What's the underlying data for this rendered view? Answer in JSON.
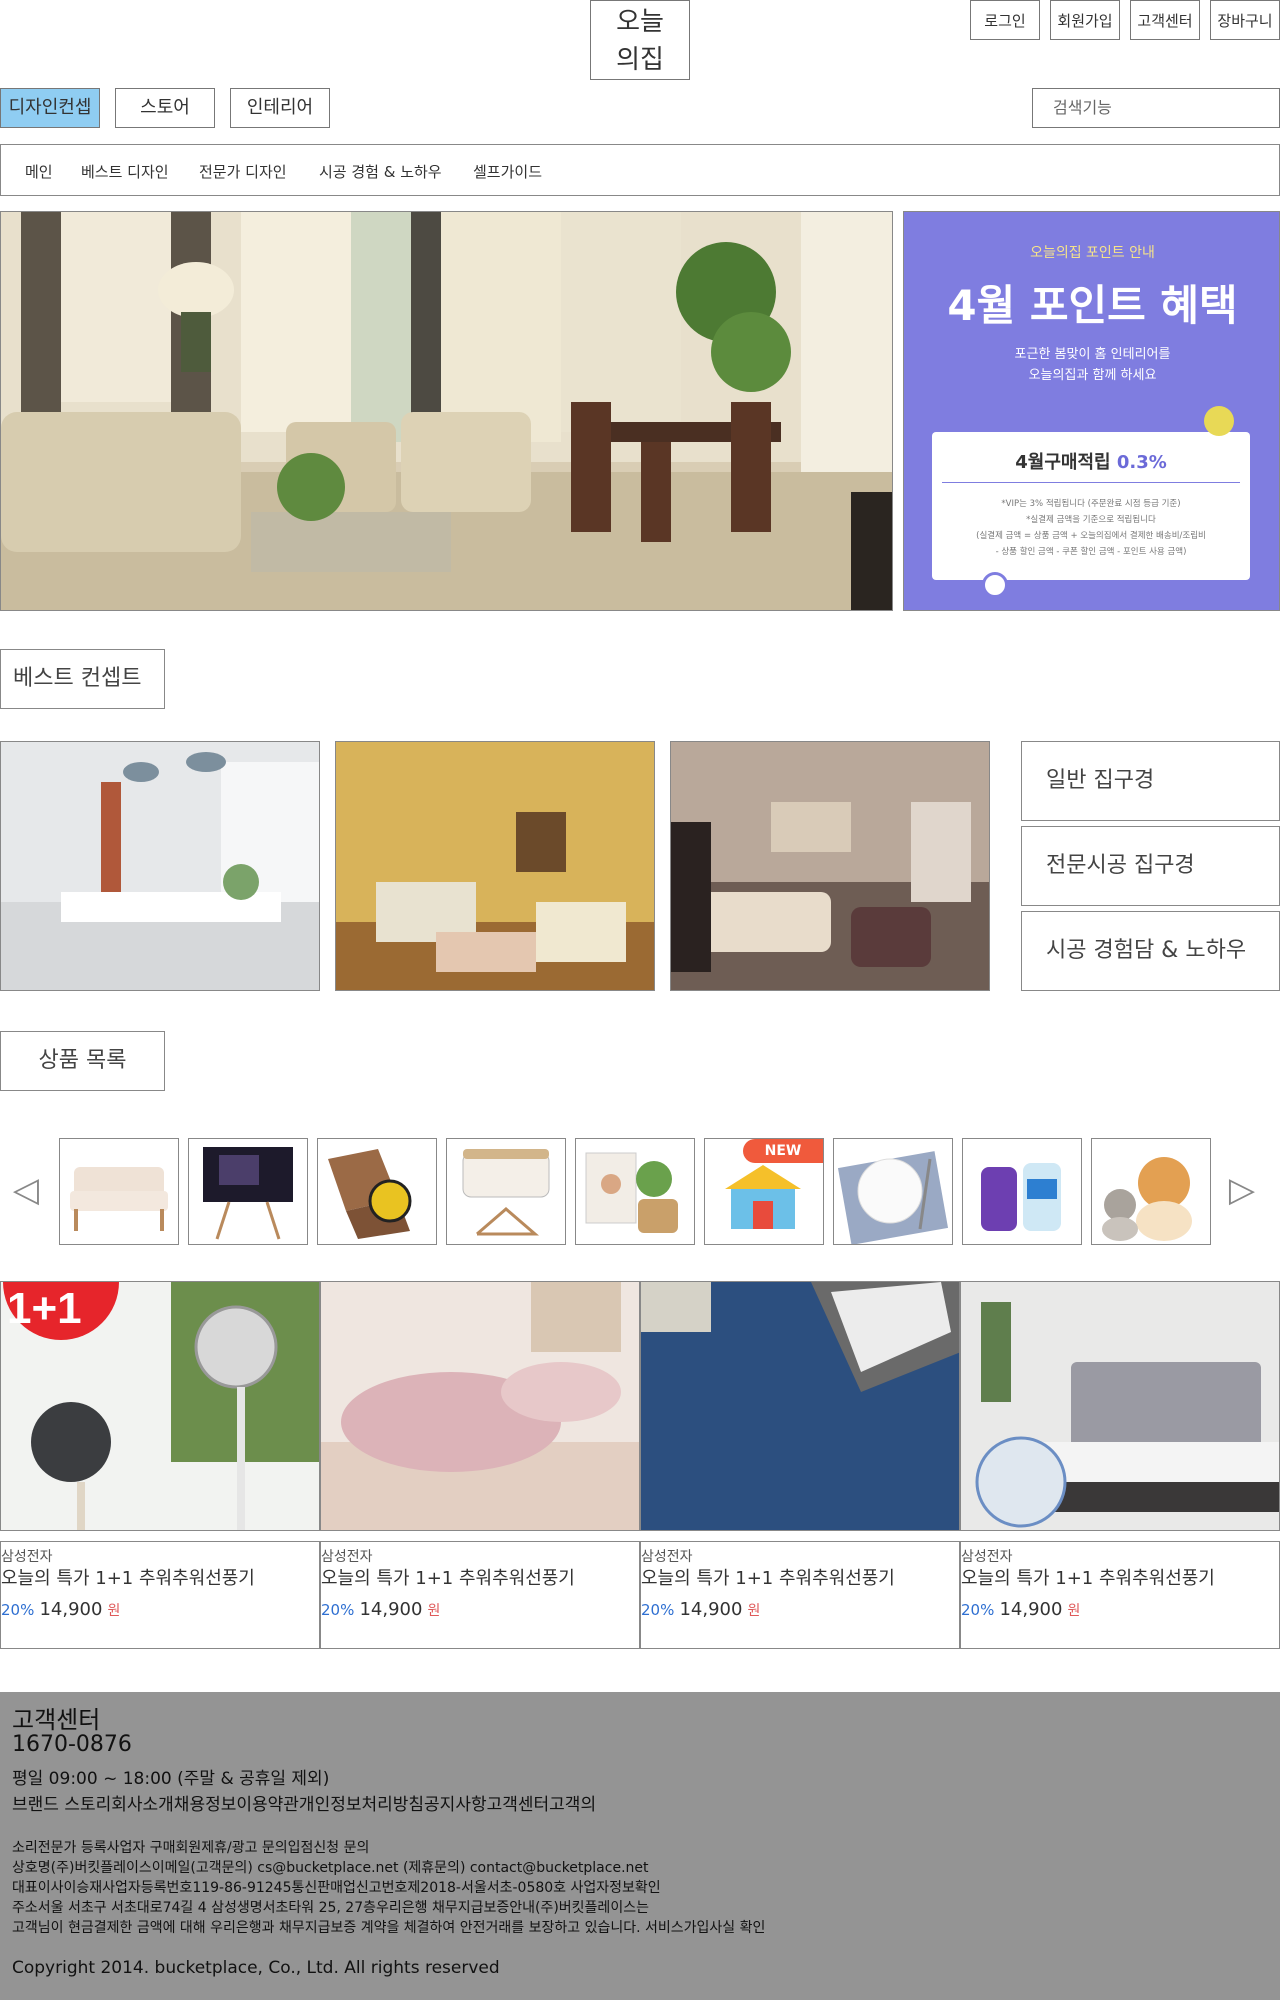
{
  "header": {
    "logo": [
      "오늘",
      "의집"
    ],
    "util_links": [
      "로그인",
      "회원가입",
      "고객센터",
      "장바구니"
    ],
    "tabs": [
      "디자인컨셉",
      "스토어",
      "인테리어"
    ],
    "active_tab": "디자인컨셉",
    "search_placeholder": "검색기능"
  },
  "subnav": [
    "메인",
    "베스트 디자인",
    "전문가 디자인",
    "시공 경험 & 노하우",
    "셀프가이드"
  ],
  "hero_banner": {
    "caption": "오늘의집 포인트 안내",
    "title": "4월 포인트 혜택",
    "subtitle_lines": [
      "포근한 봄맞이 홈 인테리어를",
      "오늘의집과 함께 하세요"
    ],
    "card_title": "4월구매적립",
    "card_rate": "0.3%",
    "card_notes": [
      "*VIP는 3% 적립됩니다 (주문완료 시점 등급 기준)",
      "*실결제 금액을 기준으로 적립됩니다",
      "(실결제 금액 = 상품 금액 + 오늘의집에서 결제한 배송비/조립비",
      "- 상품 할인 금액 - 쿠폰 할인 금액 - 포인트 사용 금액)"
    ]
  },
  "best_concept": {
    "title": "베스트 컨셉트",
    "buttons": [
      "일반 집구경",
      "전문시공 집구경",
      "시공 경험담 & 노하우"
    ]
  },
  "product_list": {
    "title": "상품 목록",
    "thumb_badge": "NEW",
    "prev_icon": "◁",
    "next_icon": "▷"
  },
  "products": [
    {
      "brand": "삼성전자",
      "name": "오늘의 특가 1+1 추워추워선풍기",
      "discount": "20%",
      "price": "14,900",
      "unit": "원",
      "badge": "1+1"
    },
    {
      "brand": "삼성전자",
      "name": "오늘의 특가 1+1 추워추워선풍기",
      "discount": "20%",
      "price": "14,900",
      "unit": "원"
    },
    {
      "brand": "삼성전자",
      "name": "오늘의 특가 1+1 추워추워선풍기",
      "discount": "20%",
      "price": "14,900",
      "unit": "원"
    },
    {
      "brand": "삼성전자",
      "name": "오늘의 특가 1+1 추워추워선풍기",
      "discount": "20%",
      "price": "14,900",
      "unit": "원"
    }
  ],
  "footer": {
    "title": "고객센터",
    "phone": "1670-0876",
    "hours": "평일 09:00 ~ 18:00 (주말 & 공휴일 제외)",
    "links": "브랜드 스토리회사소개채용정보이용약관개인정보처리방침공지사항고객센터고객의",
    "lines": [
      "소리전문가 등록사업자 구매회원제휴/광고 문의입점신청 문의",
      "상호명(주)버킷플레이스이메일(고객문의) cs@bucketplace.net (제휴문의) contact@bucketplace.net",
      "대표이사이승재사업자등록번호119-86-91245통신판매업신고번호제2018-서울서초-0580호 사업자정보확인",
      "주소서울 서초구 서초대로74길 4 삼성생명서초타워 25, 27층우리은행 채무지급보증안내(주)버킷플레이스는",
      "고객님이 현금결제한  금액에 대해 우리은행과 채무지급보증 계약을 체결하여 안전거래를 보장하고 있습니다. 서비스가입사실 확인"
    ],
    "copyright": "Copyright 2014. bucketplace, Co., Ltd. All rights reserved"
  }
}
